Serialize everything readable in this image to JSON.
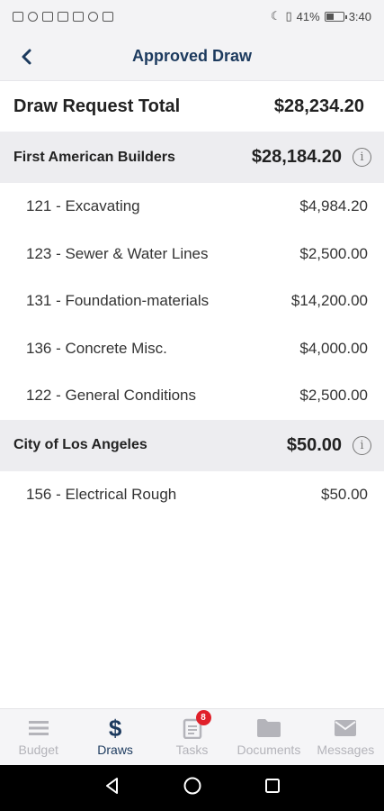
{
  "status_bar": {
    "battery": "41%",
    "time": "3:40"
  },
  "header": {
    "title": "Approved Draw"
  },
  "summary": {
    "label": "Draw Request Total",
    "value": "$28,234.20"
  },
  "groups": [
    {
      "name": "First American Builders",
      "total": "$28,184.20",
      "items": [
        {
          "label": "121 - Excavating",
          "amount": "$4,984.20"
        },
        {
          "label": "123 - Sewer & Water Lines",
          "amount": "$2,500.00"
        },
        {
          "label": "131 - Foundation-materials",
          "amount": "$14,200.00"
        },
        {
          "label": "136 - Concrete Misc.",
          "amount": "$4,000.00"
        },
        {
          "label": "122 - General Conditions",
          "amount": "$2,500.00"
        }
      ]
    },
    {
      "name": "City of Los Angeles",
      "total": "$50.00",
      "items": [
        {
          "label": "156 - Electrical Rough",
          "amount": "$50.00"
        }
      ]
    }
  ],
  "tabs": [
    {
      "label": "Budget",
      "icon": "menu-icon"
    },
    {
      "label": "Draws",
      "icon": "dollar-icon",
      "active": true
    },
    {
      "label": "Tasks",
      "icon": "clipboard-icon",
      "badge": "8"
    },
    {
      "label": "Documents",
      "icon": "folder-icon"
    },
    {
      "label": "Messages",
      "icon": "mail-icon"
    }
  ],
  "colors": {
    "primary": "#1c3a5e",
    "badge": "#e0202a",
    "inactive": "#b4b4ba"
  }
}
